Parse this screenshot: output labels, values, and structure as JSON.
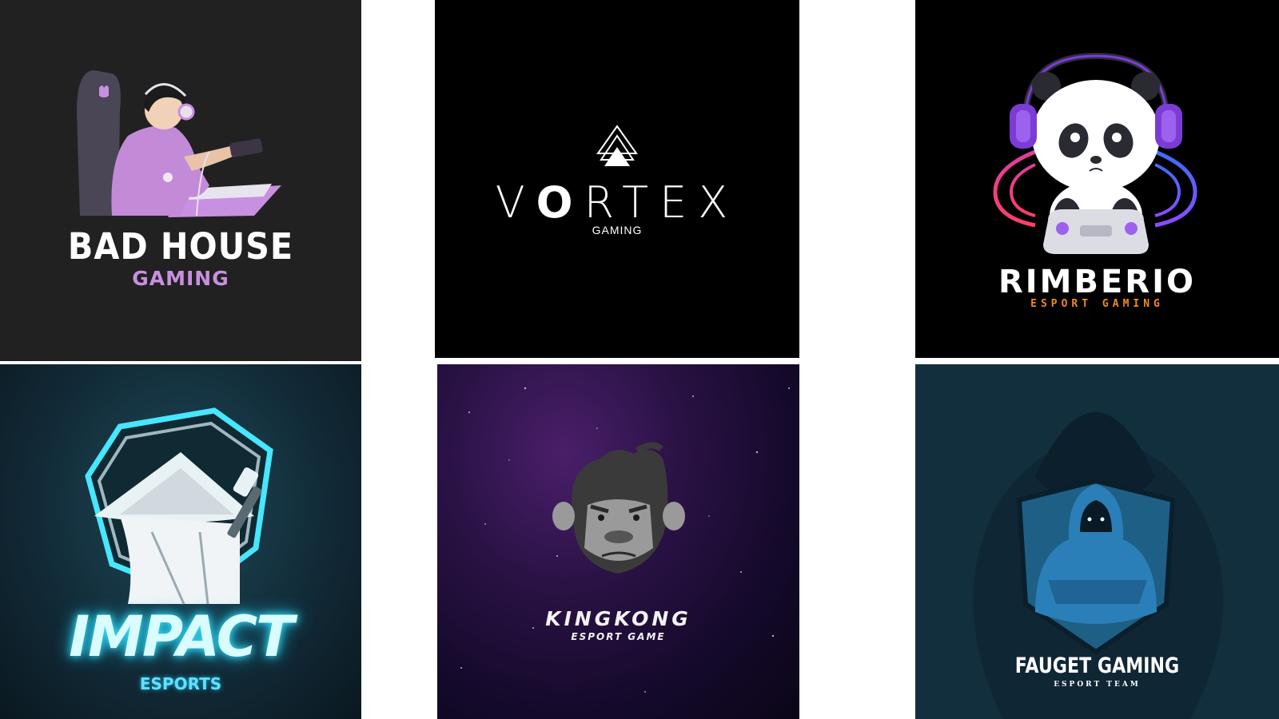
{
  "logos": [
    {
      "title": "BAD HOUSE",
      "subtitle": "GAMING",
      "icon": "gamer-girl-icon"
    },
    {
      "title_parts": [
        "V",
        "O",
        "RTE",
        "X"
      ],
      "subtitle": "GAMING",
      "icon": "triangle-icon"
    },
    {
      "title": "RIMBERIO",
      "subtitle": "ESPORT GAMING",
      "icon": "panda-icon"
    },
    {
      "title": "IMPACT",
      "subtitle": "ESPORTS",
      "icon": "samurai-icon"
    },
    {
      "title": "KINGKONG",
      "subtitle": "ESPORT GAME",
      "icon": "gorilla-icon"
    },
    {
      "title": "FAUGET GAMING",
      "subtitle": "ESPORT TEAM",
      "icon": "hooded-figure-icon"
    }
  ],
  "colors": {
    "bad_house_accent": "#c890e0",
    "rimberio_accent": "#ef8a1e",
    "impact_glow": "#3ee6ff",
    "fauget_bg": "#122f3e"
  }
}
